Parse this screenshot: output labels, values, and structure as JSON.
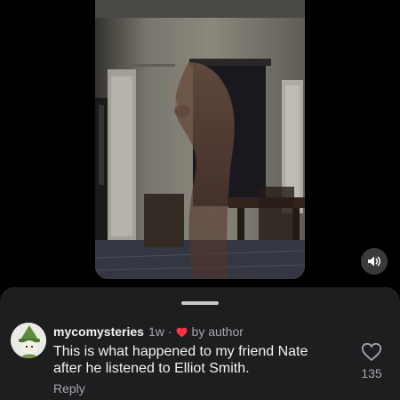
{
  "comment": {
    "username": "mycomysteries",
    "time": "1w",
    "separator": "·",
    "by_author": "by author",
    "text": "This is what happened to my friend Nate after he listened to Elliot Smith.",
    "reply_label": "Reply",
    "like_count": "135"
  },
  "colors": {
    "background": "#000000",
    "sheet": "#1d1e20",
    "secondary_text": "#a6a6ab",
    "heart_red": "#ff3040"
  },
  "icons": {
    "sound": "speaker-on-icon",
    "like": "heart-outline-icon",
    "author_liked": "heart-filled-icon"
  }
}
